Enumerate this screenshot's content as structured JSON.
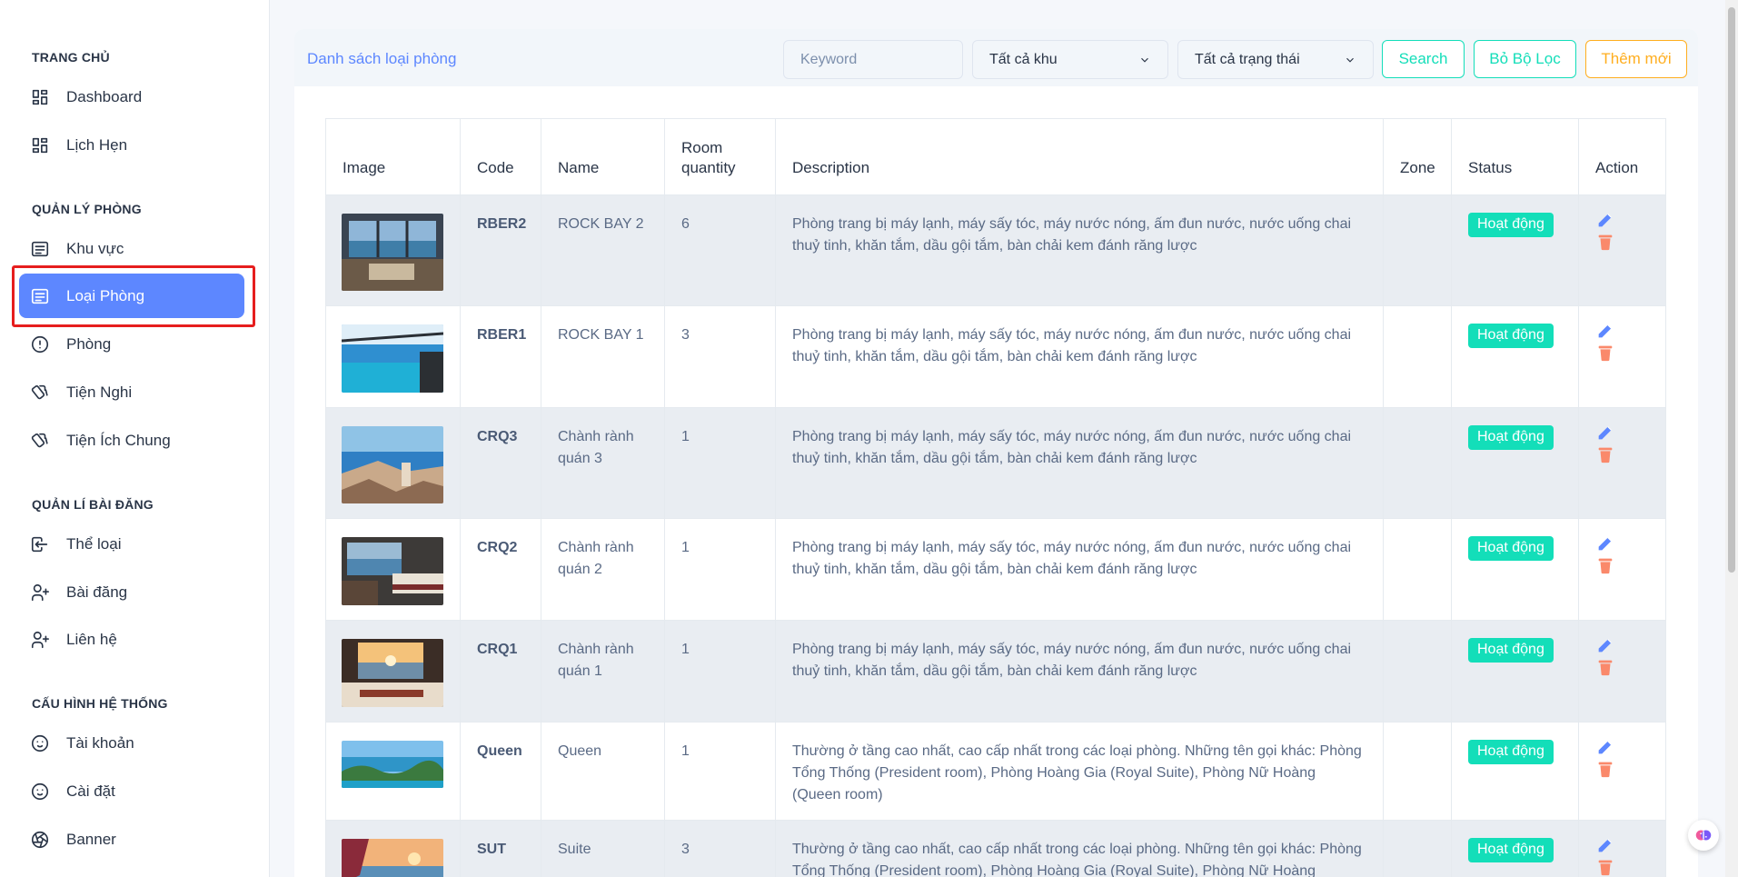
{
  "sidebar": {
    "sections": [
      {
        "title": "TRANG CHỦ",
        "items": [
          {
            "label": "Dashboard",
            "icon": "grid-icon"
          },
          {
            "label": "Lịch Hẹn",
            "icon": "grid-icon"
          }
        ]
      },
      {
        "title": "QUẢN LÝ PHÒNG",
        "items": [
          {
            "label": "Khu vực",
            "icon": "list-icon"
          },
          {
            "label": "Loại Phòng",
            "icon": "list-icon"
          },
          {
            "label": "Phòng",
            "icon": "alert-circle-icon"
          },
          {
            "label": "Tiện Nghi",
            "icon": "cards-icon"
          },
          {
            "label": "Tiện Ích Chung",
            "icon": "cards-icon"
          }
        ]
      },
      {
        "title": "QUẢN LÍ BÀI ĐĂNG",
        "items": [
          {
            "label": "Thể loại",
            "icon": "login-icon"
          },
          {
            "label": "Bài đăng",
            "icon": "user-plus-icon"
          },
          {
            "label": "Liên hệ",
            "icon": "user-plus-icon"
          }
        ]
      },
      {
        "title": "CẤU HÌNH HỆ THỐNG",
        "items": [
          {
            "label": "Tài khoản",
            "icon": "mood-icon"
          },
          {
            "label": "Cài đặt",
            "icon": "mood-icon"
          },
          {
            "label": "Banner",
            "icon": "aperture-icon"
          }
        ]
      }
    ],
    "active_item": "Loại Phòng"
  },
  "toolbar": {
    "title": "Danh sách loại phòng",
    "keyword_placeholder": "Keyword",
    "zone_select": "Tất cả khu",
    "status_select": "Tất cả trạng thái",
    "search_label": "Search",
    "clear_filter_label": "Bỏ Bộ Lọc",
    "add_new_label": "Thêm mới"
  },
  "table": {
    "headers": {
      "image": "Image",
      "code": "Code",
      "name": "Name",
      "room_quantity": "Room quantity",
      "description": "Description",
      "zone": "Zone",
      "status": "Status",
      "action": "Action"
    },
    "rows": [
      {
        "code": "RBER2",
        "name": "ROCK BAY 2",
        "qty": "6",
        "description": "Phòng trang bị máy lạnh, máy sấy tóc, máy nước nóng, ấm đun nước, nước uống chai thuỷ tinh, khăn tắm, dầu gội tắm, bàn chải kem đánh răng lược",
        "zone": "",
        "status": "Hoạt động",
        "thumb": "hotel-room-sea-view"
      },
      {
        "code": "RBER1",
        "name": "ROCK BAY 1",
        "qty": "3",
        "description": "Phòng trang bị máy lạnh, máy sấy tóc, máy nước nóng, ấm đun nước, nước uống chai thuỷ tinh, khăn tắm, dầu gội tắm, bàn chải kem đánh răng lược",
        "zone": "",
        "status": "Hoạt động",
        "thumb": "infinity-pool"
      },
      {
        "code": "CRQ3",
        "name": "Chành rành quán 3",
        "qty": "1",
        "description": "Phòng trang bị máy lạnh, máy sấy tóc, máy nước nóng, ấm đun nước, nước uống chai thuỷ tinh, khăn tắm, dầu gội tắm, bàn chải kem đánh răng lược",
        "zone": "",
        "status": "Hoạt động",
        "thumb": "coastal-rocks"
      },
      {
        "code": "CRQ2",
        "name": "Chành rành quán 2",
        "qty": "1",
        "description": "Phòng trang bị máy lạnh, máy sấy tóc, máy nước nóng, ấm đun nước, nước uống chai thuỷ tinh, khăn tắm, dầu gội tắm, bàn chải kem đánh răng lược",
        "zone": "",
        "status": "Hoạt động",
        "thumb": "bedroom-interior"
      },
      {
        "code": "CRQ1",
        "name": "Chành rành quán 1",
        "qty": "1",
        "description": "Phòng trang bị máy lạnh, máy sấy tóc, máy nước nóng, ấm đun nước, nước uống chai thuỷ tinh, khăn tắm, dầu gội tắm, bàn chải kem đánh răng lược",
        "zone": "",
        "status": "Hoạt động",
        "thumb": "sunset-bedroom"
      },
      {
        "code": "Queen",
        "name": "Queen",
        "qty": "1",
        "description": "Thường ở tầng cao nhất, cao cấp nhất trong các loại phòng. Những tên gọi khác: Phòng Tổng Thống (President room), Phòng Hoàng Gia (Royal Suite), Phòng Nữ Hoàng (Queen room)",
        "zone": "",
        "status": "Hoạt động",
        "thumb": "bay-islands"
      },
      {
        "code": "SUT",
        "name": "Suite",
        "qty": "3",
        "description": "Thường ở tầng cao nhất, cao cấp nhất trong các loại phòng. Những tên gọi khác: Phòng Tổng Thống (President room), Phòng Hoàng Gia (Royal Suite), Phòng Nữ Hoàng (Queen room)",
        "zone": "",
        "status": "Hoạt động",
        "thumb": "beach-sunset"
      }
    ]
  },
  "colors": {
    "primary": "#5d87ff",
    "success": "#13deb9",
    "warning": "#ffae1f",
    "danger": "#fa896b",
    "highlight": "#e61e1e"
  }
}
